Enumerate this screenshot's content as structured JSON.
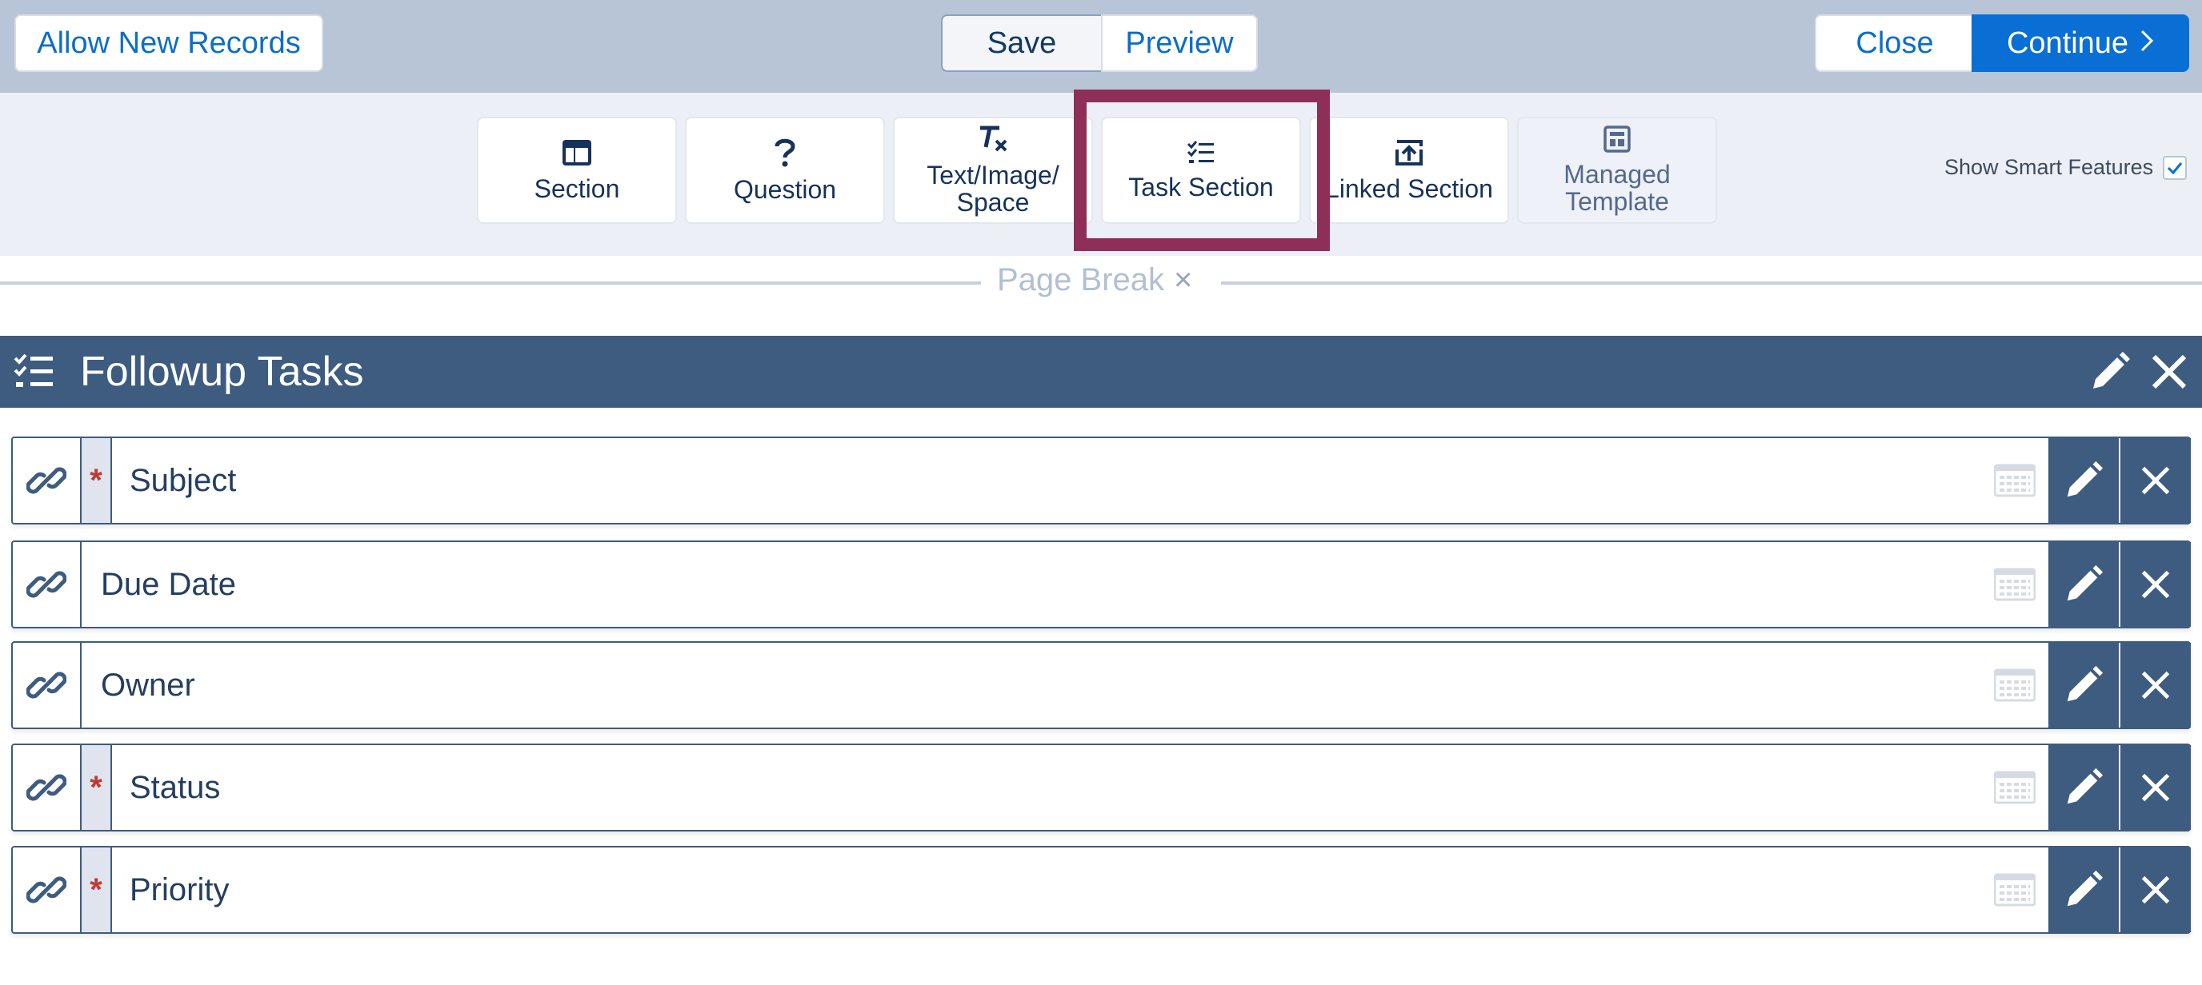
{
  "topbar": {
    "allow_new_records": "Allow New Records",
    "save": "Save",
    "preview": "Preview",
    "close": "Close",
    "continue": "Continue"
  },
  "toolbar": {
    "items": [
      {
        "label": "Section",
        "icon": "section-icon"
      },
      {
        "label": "Question",
        "icon": "question-icon"
      },
      {
        "label": "Text/Image/ Space",
        "icon": "clear-format-icon"
      },
      {
        "label": "Task Section",
        "icon": "task-list-icon",
        "highlighted": true
      },
      {
        "label": "Linked Section",
        "icon": "linked-upload-icon"
      },
      {
        "label": "Managed Template",
        "icon": "template-icon"
      }
    ],
    "show_smart_features": "Show Smart Features",
    "show_smart_features_checked": true
  },
  "page_break": {
    "label": "Page Break",
    "close_glyph": "×"
  },
  "section": {
    "title": "Followup Tasks",
    "rows": [
      {
        "label": "Subject",
        "required": true
      },
      {
        "label": "Due Date",
        "required": false
      },
      {
        "label": "Owner",
        "required": false
      },
      {
        "label": "Status",
        "required": true
      },
      {
        "label": "Priority",
        "required": true
      }
    ]
  },
  "colors": {
    "topbar_bg": "#b8c5d7",
    "toolbar_bg": "#ecf0f6",
    "section_header_bg": "#3d5c80",
    "brand_blue": "#0a6fd4",
    "highlight": "#8e2f58",
    "required": "#c23934"
  }
}
